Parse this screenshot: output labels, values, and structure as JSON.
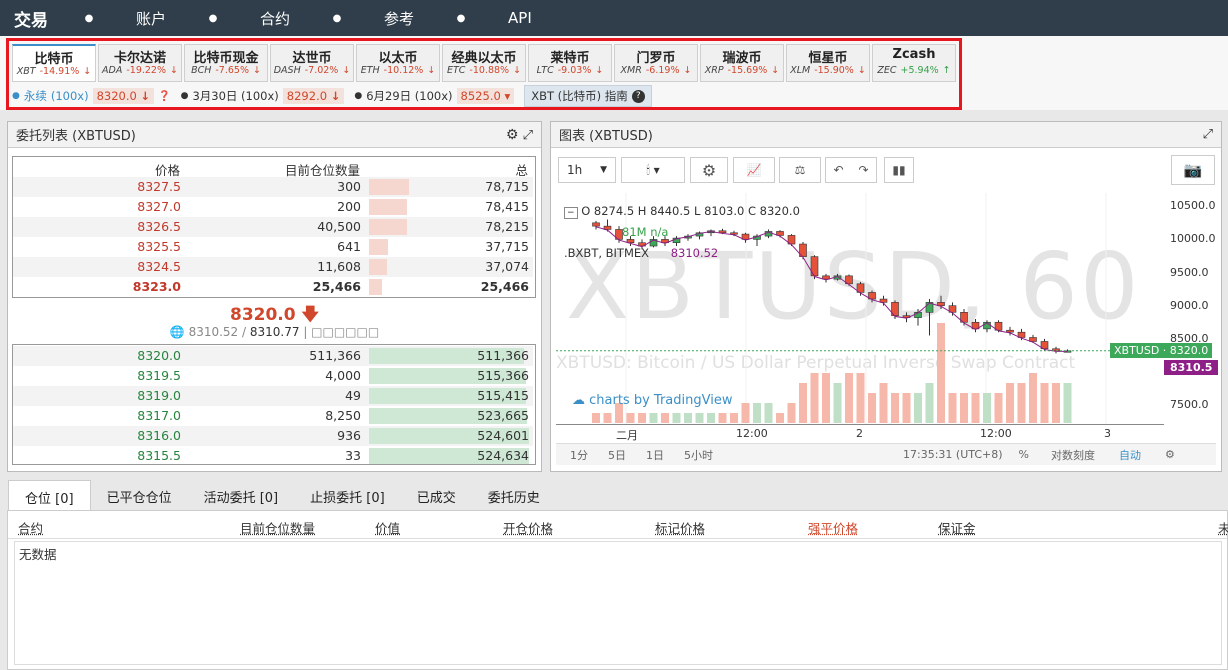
{
  "nav": {
    "brand": "交易",
    "items": [
      "账户",
      "合约",
      "参考",
      "API"
    ]
  },
  "tabs": [
    {
      "name": "比特币",
      "sym": "XBT",
      "chg": "-14.91%",
      "dir": "neg"
    },
    {
      "name": "卡尔达诺",
      "sym": "ADA",
      "chg": "-19.22%",
      "dir": "neg"
    },
    {
      "name": "比特币现金",
      "sym": "BCH",
      "chg": "-7.65%",
      "dir": "neg"
    },
    {
      "name": "达世币",
      "sym": "DASH",
      "chg": "-7.02%",
      "dir": "neg"
    },
    {
      "name": "以太币",
      "sym": "ETH",
      "chg": "-10.12%",
      "dir": "neg"
    },
    {
      "name": "经典以太币",
      "sym": "ETC",
      "chg": "-10.88%",
      "dir": "neg"
    },
    {
      "name": "莱特币",
      "sym": "LTC",
      "chg": "-9.03%",
      "dir": "neg"
    },
    {
      "name": "门罗币",
      "sym": "XMR",
      "chg": "-6.19%",
      "dir": "neg"
    },
    {
      "name": "瑞波币",
      "sym": "XRP",
      "chg": "-15.69%",
      "dir": "neg"
    },
    {
      "name": "恒星币",
      "sym": "XLM",
      "chg": "-15.90%",
      "dir": "neg"
    },
    {
      "name": "Zcash",
      "sym": "ZEC",
      "chg": "+5.94%",
      "dir": "pos"
    }
  ],
  "contracts": {
    "perp": "永续",
    "perp_lev": "(100x)",
    "perp_price": "8320.0",
    "mar": "3月30日 (100x)",
    "mar_price": "8292.0",
    "jun": "6月29日 (100x)",
    "jun_price": "8525.0",
    "guide": "XBT (比特币) 指南"
  },
  "orderbook": {
    "title": "委托列表 (XBTUSD)",
    "headers": {
      "price": "价格",
      "size": "目前仓位数量",
      "total": "总"
    },
    "asks": [
      {
        "price": "8327.5",
        "size": "300",
        "total": "78,715",
        "depth": 0.25
      },
      {
        "price": "8327.0",
        "size": "200",
        "total": "78,415",
        "depth": 0.24
      },
      {
        "price": "8326.5",
        "size": "40,500",
        "total": "78,215",
        "depth": 0.24
      },
      {
        "price": "8325.5",
        "size": "641",
        "total": "37,715",
        "depth": 0.12
      },
      {
        "price": "8324.5",
        "size": "11,608",
        "total": "37,074",
        "depth": 0.11
      },
      {
        "price": "8323.0",
        "size": "25,466",
        "total": "25,466",
        "depth": 0.08
      }
    ],
    "last": "8320.0",
    "index": "8310.52",
    "mark": "8310.77",
    "extra": "| □□□□□□",
    "bids": [
      {
        "price": "8320.0",
        "size": "511,366",
        "total": "511,366",
        "depth": 0.97
      },
      {
        "price": "8319.5",
        "size": "4,000",
        "total": "515,366",
        "depth": 0.98
      },
      {
        "price": "8319.0",
        "size": "49",
        "total": "515,415",
        "depth": 0.98
      },
      {
        "price": "8317.0",
        "size": "8,250",
        "total": "523,665",
        "depth": 0.99
      },
      {
        "price": "8316.0",
        "size": "936",
        "total": "524,601",
        "depth": 1.0
      },
      {
        "price": "8315.5",
        "size": "33",
        "total": "524,634",
        "depth": 1.0
      }
    ]
  },
  "chart": {
    "title": "图表 (XBTUSD)",
    "interval": "1h",
    "ohlc": "O 8274.5 H 8440.5 L 8103.0 C 8320.0",
    "vol": "81M n/a",
    "index_label": ".BXBT, BITMEX",
    "index_val": "8310.52",
    "watermark": "XBTUSD, 60",
    "watermark2": "XBTUSD: Bitcoin / US Dollar Perpetual Inverse Swap Contract",
    "credit": "charts by TradingView",
    "yticks": [
      "10500.0",
      "10000.0",
      "9500.0",
      "9000.0",
      "8500.0",
      "7500.0"
    ],
    "xticks": [
      "二月",
      "12:00",
      "2",
      "12:00",
      "3"
    ],
    "last_tag": "XBTUSD · 8320.0",
    "index_tag": "8310.5",
    "ranges": [
      "1分",
      "5日",
      "1日",
      "5小时"
    ],
    "time": "17:35:31 (UTC+8)",
    "pct": "%",
    "logscale": "对数刻度",
    "auto": "自动"
  },
  "chart_data": {
    "type": "candlestick",
    "candles": [
      [
        10250,
        10280,
        10150,
        10200
      ],
      [
        10200,
        10300,
        10120,
        10150
      ],
      [
        10150,
        10200,
        9950,
        10000
      ],
      [
        10000,
        10050,
        9900,
        9950
      ],
      [
        9950,
        10000,
        9850,
        9900
      ],
      [
        9900,
        10050,
        9880,
        10000
      ],
      [
        10000,
        10050,
        9900,
        9950
      ],
      [
        9950,
        10050,
        9900,
        10020
      ],
      [
        10020,
        10080,
        9980,
        10050
      ],
      [
        10050,
        10120,
        10000,
        10100
      ],
      [
        10100,
        10150,
        10050,
        10130
      ],
      [
        10130,
        10160,
        10080,
        10100
      ],
      [
        10100,
        10130,
        10050,
        10080
      ],
      [
        10080,
        10100,
        9950,
        10000
      ],
      [
        10000,
        10080,
        9900,
        10050
      ],
      [
        10050,
        10150,
        10020,
        10120
      ],
      [
        10120,
        10140,
        10030,
        10060
      ],
      [
        10060,
        10080,
        9900,
        9930
      ],
      [
        9930,
        9960,
        9700,
        9740
      ],
      [
        9740,
        9760,
        9400,
        9450
      ],
      [
        9450,
        9480,
        9350,
        9400
      ],
      [
        9400,
        9480,
        9380,
        9450
      ],
      [
        9450,
        9470,
        9300,
        9330
      ],
      [
        9330,
        9360,
        9150,
        9200
      ],
      [
        9200,
        9230,
        9050,
        9100
      ],
      [
        9100,
        9150,
        9000,
        9050
      ],
      [
        9050,
        9080,
        8800,
        8850
      ],
      [
        8850,
        8900,
        8750,
        8820
      ],
      [
        8820,
        8950,
        8700,
        8900
      ],
      [
        8900,
        9100,
        8550,
        9050
      ],
      [
        9050,
        9150,
        8950,
        9000
      ],
      [
        9000,
        9050,
        8850,
        8900
      ],
      [
        8900,
        8950,
        8700,
        8750
      ],
      [
        8750,
        8800,
        8600,
        8650
      ],
      [
        8650,
        8780,
        8600,
        8750
      ],
      [
        8750,
        8780,
        8600,
        8630
      ],
      [
        8630,
        8680,
        8550,
        8600
      ],
      [
        8600,
        8650,
        8480,
        8520
      ],
      [
        8520,
        8560,
        8440,
        8460
      ],
      [
        8460,
        8500,
        8320,
        8350
      ],
      [
        8350,
        8380,
        8280,
        8320
      ],
      [
        8320,
        8340,
        8300,
        8320
      ]
    ],
    "volumes": [
      1,
      1,
      2,
      1,
      1,
      1,
      1,
      1,
      1,
      1,
      1,
      1,
      1,
      2,
      2,
      2,
      1,
      2,
      4,
      5,
      5,
      4,
      5,
      5,
      3,
      4,
      3,
      3,
      3,
      4,
      10,
      3,
      3,
      3,
      3,
      3,
      4,
      4,
      5,
      4,
      4,
      4
    ],
    "ylim": [
      7200,
      10700
    ]
  },
  "bottom": {
    "tabs": [
      "仓位 [0]",
      "已平仓仓位",
      "活动委托 [0]",
      "止损委托 [0]",
      "已成交",
      "委托历史"
    ],
    "cols": [
      "合约",
      "目前仓位数量",
      "价值",
      "开仓价格",
      "标记价格",
      "强平价格",
      "保证金",
      "未"
    ],
    "empty": "无数据"
  }
}
